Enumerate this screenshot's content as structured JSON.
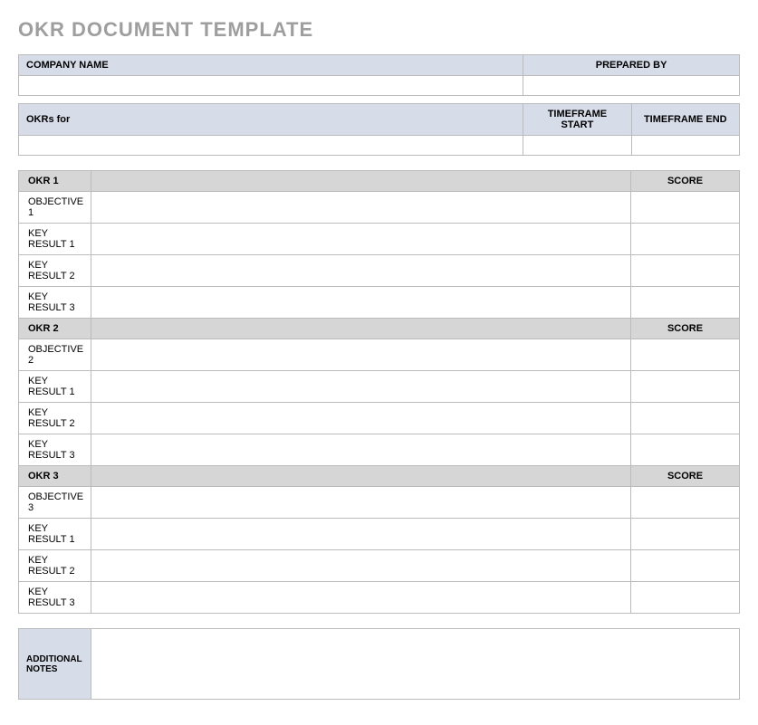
{
  "title": "OKR DOCUMENT TEMPLATE",
  "header": {
    "company_name_label": "COMPANY NAME",
    "prepared_by_label": "PREPARED BY",
    "company_name_value": "",
    "prepared_by_value": "",
    "okrs_for_label": "OKRs for",
    "timeframe_start_label": "TIMEFRAME START",
    "timeframe_end_label": "TIMEFRAME END",
    "okrs_for_value": "",
    "timeframe_start_value": "",
    "timeframe_end_value": ""
  },
  "okrs": [
    {
      "title": "OKR 1",
      "score_label": "SCORE",
      "objective_label": "OBJECTIVE 1",
      "objective_value": "",
      "objective_score": "",
      "key_results": [
        {
          "label": "KEY RESULT 1",
          "value": "",
          "score": ""
        },
        {
          "label": "KEY RESULT 2",
          "value": "",
          "score": ""
        },
        {
          "label": "KEY RESULT 3",
          "value": "",
          "score": ""
        }
      ]
    },
    {
      "title": "OKR 2",
      "score_label": "SCORE",
      "objective_label": "OBJECTIVE 2",
      "objective_value": "",
      "objective_score": "",
      "key_results": [
        {
          "label": "KEY RESULT 1",
          "value": "",
          "score": ""
        },
        {
          "label": "KEY RESULT 2",
          "value": "",
          "score": ""
        },
        {
          "label": "KEY RESULT 3",
          "value": "",
          "score": ""
        }
      ]
    },
    {
      "title": "OKR 3",
      "score_label": "SCORE",
      "objective_label": "OBJECTIVE 3",
      "objective_value": "",
      "objective_score": "",
      "key_results": [
        {
          "label": "KEY RESULT 1",
          "value": "",
          "score": ""
        },
        {
          "label": "KEY RESULT 2",
          "value": "",
          "score": ""
        },
        {
          "label": "KEY RESULT 3",
          "value": "",
          "score": ""
        }
      ]
    }
  ],
  "notes": {
    "label": "ADDITIONAL NOTES",
    "value": ""
  }
}
